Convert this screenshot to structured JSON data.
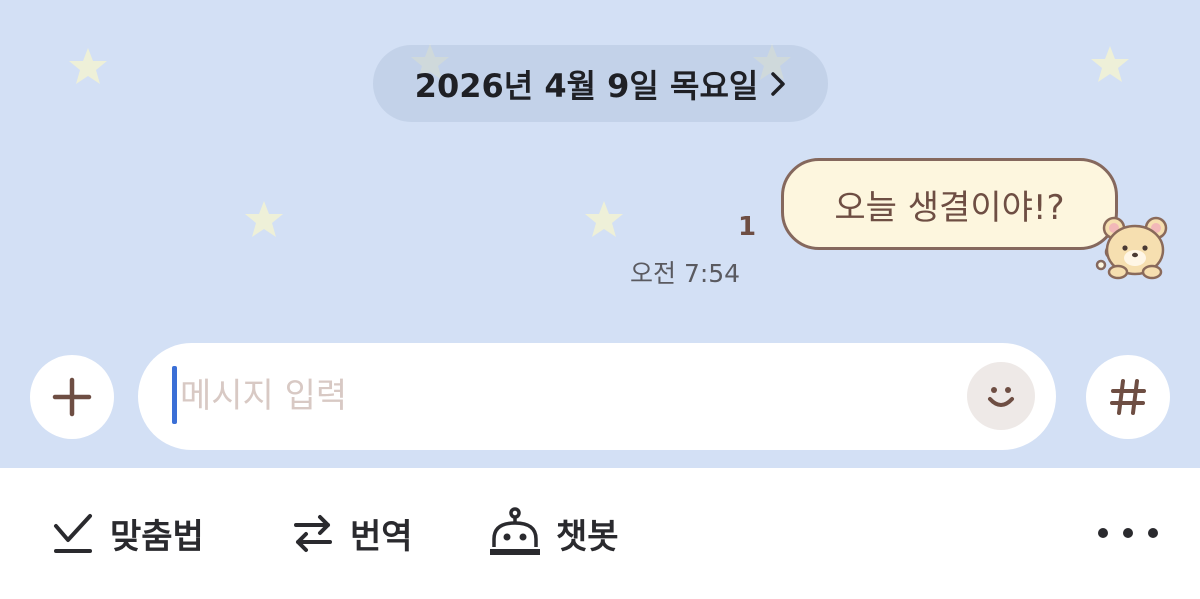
{
  "chat": {
    "date_label": "2026년 4월 9일 목요일",
    "message": {
      "text": "오늘 생결이야!?",
      "unread_count": "1",
      "time": "오전 7:54"
    }
  },
  "composer": {
    "placeholder": "메시지 입력"
  },
  "toolbar": {
    "spell_label": "맞춤법",
    "translate_label": "번역",
    "chatbot_label": "챗봇"
  },
  "icons": {
    "plus": "plus-icon",
    "emoji": "smile-icon",
    "hashtag": "hashtag-icon",
    "spell": "checkmark-icon",
    "translate": "swap-arrows-icon",
    "chatbot": "robot-icon",
    "more": "more-horizontal-icon"
  },
  "colors": {
    "chat_background": "#d3e0f5",
    "bubble_fill": "#fdf6de",
    "bubble_border": "#85685d",
    "bubble_text": "#6e4e43",
    "caret": "#3b6fd6",
    "star": "#eef0d8"
  }
}
